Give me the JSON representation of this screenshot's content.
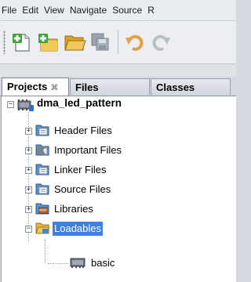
{
  "menubar": {
    "items": [
      "File",
      "Edit",
      "View",
      "Navigate",
      "Source",
      "R"
    ]
  },
  "toolbar": {
    "buttons": [
      "new-file-icon",
      "new-project-icon",
      "open-project-icon",
      "save-all-icon",
      "undo-icon",
      "redo-icon"
    ]
  },
  "tabs": [
    {
      "label": "Projects",
      "close": "⌘"
    },
    {
      "label": "Files"
    },
    {
      "label": "Classes"
    }
  ],
  "tree": {
    "project": "dma_led_pattern",
    "nodes": [
      {
        "label": "Header Files"
      },
      {
        "label": "Important Files"
      },
      {
        "label": "Linker Files"
      },
      {
        "label": "Source Files"
      },
      {
        "label": "Libraries"
      },
      {
        "label": "Loadables"
      }
    ],
    "child": "basic"
  },
  "colors": {
    "selection": "#3d80df",
    "folder_blue": "#4a86c6",
    "folder_yellow": "#e8b33a"
  }
}
